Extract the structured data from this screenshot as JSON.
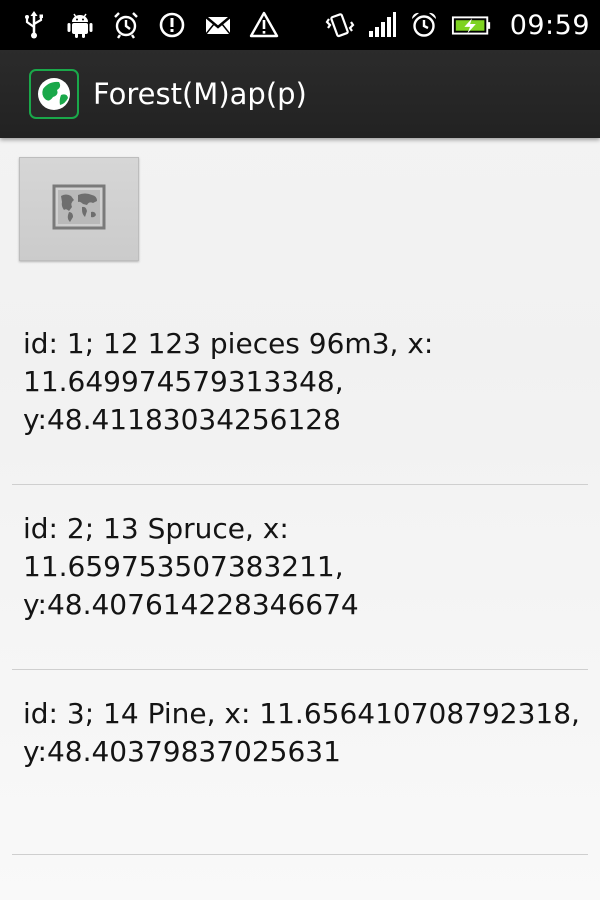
{
  "status_bar": {
    "time": "09:59",
    "left_icons": [
      "usb-icon",
      "android-debug-icon",
      "alarm-clock-icon",
      "alert-icon",
      "gmail-icon",
      "warning-icon"
    ],
    "right_icons": [
      "vibrate-icon",
      "signal-icon",
      "alarm-icon",
      "battery-charging-icon"
    ]
  },
  "action_bar": {
    "title": "Forest(M)ap(p)",
    "icon": "forest-globe-icon"
  },
  "map_button": {
    "icon": "map-icon"
  },
  "records": [
    {
      "text": "id: 1; 12 123 pieces 96m3, x: 11.649974579313348, y:48.41183034256128"
    },
    {
      "text": "id: 2; 13 Spruce, x: 11.659753507383211, y:48.407614228346674"
    },
    {
      "text": "id: 3; 14 Pine, x: 11.656410708792318, y:48.40379837025631"
    }
  ],
  "colors": {
    "status_bar": "#000000",
    "action_bar": "#262626",
    "app_icon_green": "#1aa84a",
    "background": "#f2f2f2",
    "battery_green": "#7ed321"
  }
}
